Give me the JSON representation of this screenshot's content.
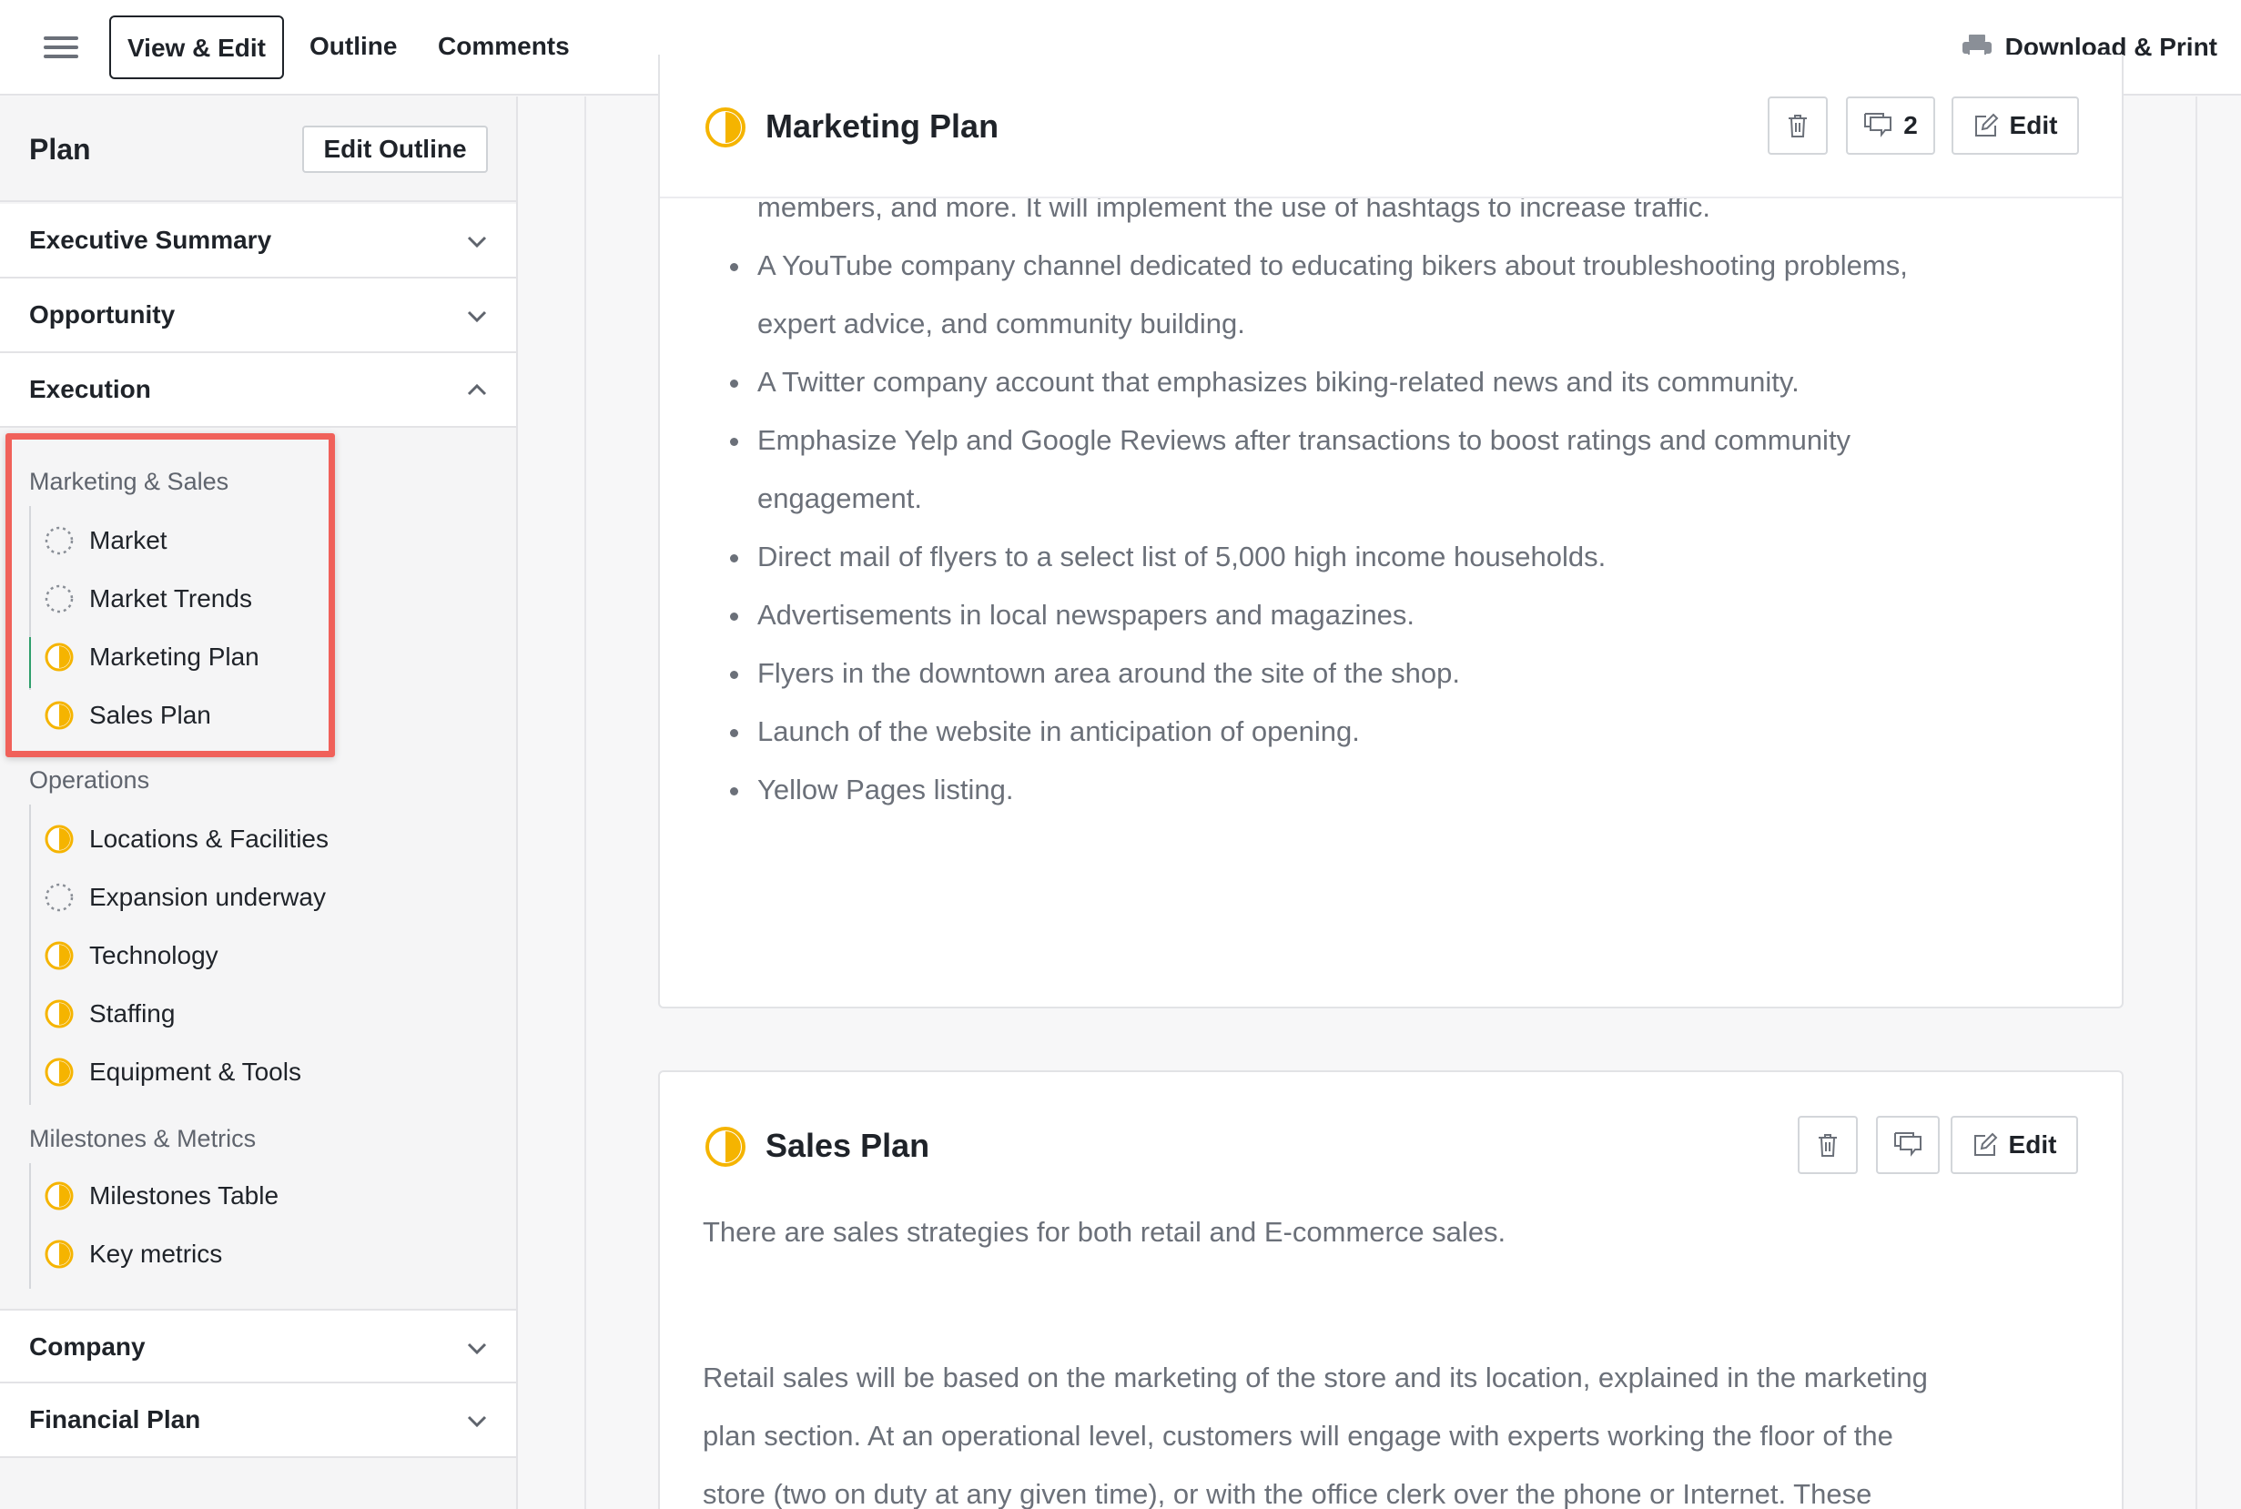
{
  "topbar": {
    "tabs": {
      "view_edit": "View & Edit",
      "outline": "Outline",
      "comments": "Comments"
    },
    "download": "Download & Print"
  },
  "sidebar": {
    "title": "Plan",
    "edit_outline": "Edit Outline",
    "sections": {
      "executive_summary": "Executive Summary",
      "opportunity": "Opportunity",
      "execution": "Execution",
      "company": "Company",
      "financial_plan": "Financial Plan"
    },
    "groups": {
      "marketing_sales": {
        "title": "Marketing & Sales",
        "items": [
          "Market",
          "Market Trends",
          "Marketing Plan",
          "Sales Plan"
        ]
      },
      "operations": {
        "title": "Operations",
        "items": [
          "Locations & Facilities",
          "Expansion underway",
          "Technology",
          "Staffing",
          "Equipment & Tools"
        ]
      },
      "milestones": {
        "title": "Milestones & Metrics",
        "items": [
          "Milestones Table",
          "Key metrics"
        ]
      }
    }
  },
  "colors": {
    "accent_yellow": "#f5b400",
    "active_green": "#2e9e6b",
    "highlight_red": "#f0615a"
  },
  "marketing_plan": {
    "title": "Marketing Plan",
    "comment_count": "2",
    "edit_label": "Edit",
    "partial_line": "members, and more. It will implement the use of hashtags to increase traffic.",
    "bullets": [
      "A YouTube company channel dedicated to educating bikers about troubleshooting problems,",
      "expert advice, and community building.",
      "A Twitter company account that emphasizes biking-related news and its community.",
      "Emphasize Yelp and Google Reviews after transactions to boost ratings and community",
      "engagement.",
      "Direct mail of flyers to a select list of 5,000 high income households.",
      "Advertisements in local newspapers and magazines.",
      "Flyers in the downtown area around the site of the shop.",
      "Launch of the website in anticipation of opening.",
      "Yellow Pages listing."
    ]
  },
  "sales_plan": {
    "title": "Sales Plan",
    "edit_label": "Edit",
    "para1": "There are sales strategies for both retail and E-commerce sales.",
    "para2_lines": [
      "Retail sales will be based on the marketing of the store and its location, explained in the marketing",
      "plan section.  At an operational level, customers will engage with experts working the floor of the",
      "store (two on duty at any given time), or with the office clerk over the phone or Internet. These"
    ]
  }
}
